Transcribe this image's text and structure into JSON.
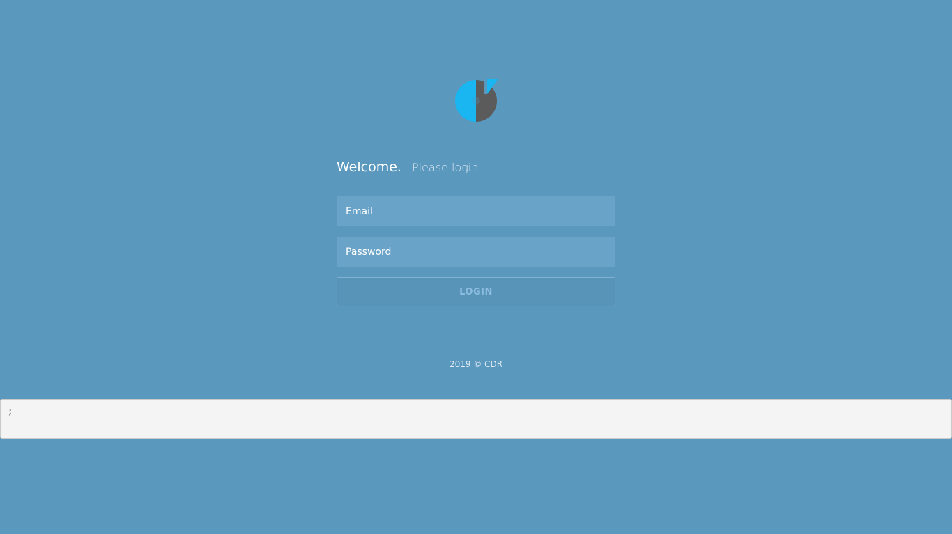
{
  "logo": {
    "icon": "app-logo-icon",
    "colors": {
      "primary": "#19b6f1",
      "secondary": "#5b5b5b"
    }
  },
  "header": {
    "welcome": "Welcome.",
    "subtitle": "Please login."
  },
  "form": {
    "email_placeholder": "Email",
    "password_placeholder": "Password",
    "login_label": "LOGIN"
  },
  "footer": {
    "text": "2019 © CDR"
  },
  "debug_output": {
    "text": ";"
  },
  "theme": {
    "background": "#5b98be",
    "field_background": "#6aa3c8",
    "button_text": "#8cbde0"
  }
}
